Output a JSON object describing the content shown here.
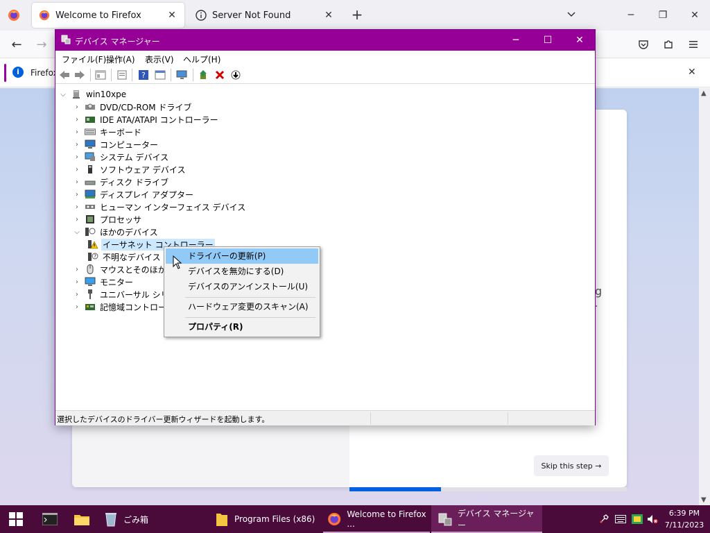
{
  "browser": {
    "tabs": [
      {
        "title": "Welcome to Firefox",
        "active": true
      },
      {
        "title": "Server Not Found",
        "active": false
      }
    ],
    "notification": {
      "text": "Firefox"
    },
    "page": {
      "partial_text_1": "g",
      "partial_text_2": ".",
      "skip_label": "Skip this step →",
      "progress_fraction": 0.33
    }
  },
  "device_manager": {
    "title": "デバイス マネージャー",
    "menu": [
      "ファイル(F)",
      "操作(A)",
      "表示(V)",
      "ヘルプ(H)"
    ],
    "tree": {
      "root": "win10xpe",
      "categories": [
        {
          "label": "DVD/CD-ROM ドライブ",
          "icon": "dvd-drive-icon",
          "expanded": false
        },
        {
          "label": "IDE ATA/ATAPI コントローラー",
          "icon": "ide-controller-icon",
          "expanded": false
        },
        {
          "label": "キーボード",
          "icon": "keyboard-icon",
          "expanded": false
        },
        {
          "label": "コンピューター",
          "icon": "computer-icon",
          "expanded": false
        },
        {
          "label": "システム デバイス",
          "icon": "system-device-icon",
          "expanded": false
        },
        {
          "label": "ソフトウェア デバイス",
          "icon": "software-device-icon",
          "expanded": false
        },
        {
          "label": "ディスク ドライブ",
          "icon": "disk-drive-icon",
          "expanded": false
        },
        {
          "label": "ディスプレイ アダプター",
          "icon": "display-adapter-icon",
          "expanded": false
        },
        {
          "label": "ヒューマン インターフェイス デバイス",
          "icon": "hid-icon",
          "expanded": false
        },
        {
          "label": "プロセッサ",
          "icon": "processor-icon",
          "expanded": false
        },
        {
          "label": "ほかのデバイス",
          "icon": "other-device-icon",
          "expanded": true
        },
        {
          "label": "マウスとそのほかのポ",
          "icon": "mouse-icon",
          "expanded": false
        },
        {
          "label": "モニター",
          "icon": "monitor-icon",
          "expanded": false
        },
        {
          "label": "ユニバーサル シリアル",
          "icon": "usb-icon",
          "expanded": false
        },
        {
          "label": "記憶域コントローラー",
          "icon": "storage-controller-icon",
          "expanded": false
        }
      ],
      "other_devices": [
        {
          "label": "イーサネット コントローラー",
          "selected": true
        },
        {
          "label": "不明なデバイス",
          "selected": false
        }
      ]
    },
    "context_menu": [
      {
        "label": "ドライバーの更新(P)",
        "highlighted": true,
        "bold": false
      },
      {
        "label": "デバイスを無効にする(D)",
        "highlighted": false,
        "bold": false
      },
      {
        "label": "デバイスのアンインストール(U)",
        "highlighted": false,
        "bold": false
      },
      {
        "label": "ハードウェア変更のスキャン(A)",
        "highlighted": false,
        "bold": false
      },
      {
        "label": "プロパティ(R)",
        "highlighted": false,
        "bold": true
      }
    ],
    "status_text": "選択したデバイスのドライバー更新ウィザードを起動します。"
  },
  "taskbar": {
    "items": [
      {
        "label": "ごみ箱",
        "icon": "recycle-bin-icon"
      },
      {
        "label": "Program Files (x86)",
        "icon": "folder-icon"
      },
      {
        "label": "Welcome to Firefox ...",
        "icon": "firefox-icon"
      },
      {
        "label": "デバイス マネージャー",
        "icon": "device-manager-icon"
      }
    ],
    "time": "6:39 PM",
    "date": "7/11/2023"
  },
  "colors": {
    "titlebar": "#960097",
    "taskbar": "#4a0a3a",
    "menu_highlight": "#91c9f7",
    "firefox_accent": "#0060df"
  }
}
